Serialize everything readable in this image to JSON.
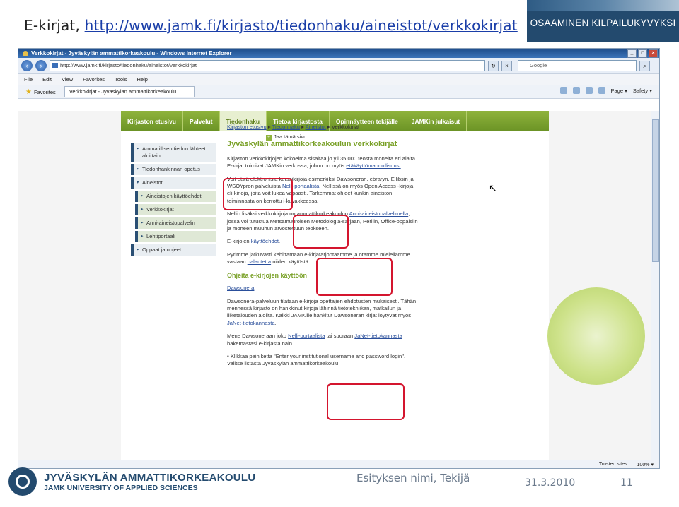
{
  "slide": {
    "title_prefix": "E-kirjat, ",
    "title_link": "http://www.jamk.fi/kirjasto/tiedonhaku/aineistot/verkkokirjat",
    "banner": "OSAAMINEN KILPAILUKYVYKSI",
    "footer_logo_line1": "JYVÄSKYLÄN AMMATTIKORKEAKOULU",
    "footer_logo_line2": "JAMK UNIVERSITY OF APPLIED SCIENCES",
    "presenter": "Esityksen nimi, Tekijä",
    "date": "31.3.2010",
    "page_number": "11"
  },
  "browser": {
    "window_title": "Verkkokirjat - Jyväskylän ammattikorkeakoulu - Windows Internet Explorer",
    "address": "http://www.jamk.fi/kirjasto/tiedonhaku/aineistot/verkkokirjat",
    "search_placeholder": "Google",
    "menu": [
      "File",
      "Edit",
      "View",
      "Favorites",
      "Tools",
      "Help"
    ],
    "favorites_label": "Favorites",
    "tab_label": "Verkkokirjat - Jyväskylän ammattikorkeakoulu",
    "cmd_page": "Page ▾",
    "cmd_safety": "Safety ▾",
    "status_trusted": "Trusted sites",
    "status_zoom": "100% ▾"
  },
  "site": {
    "nav": [
      "Kirjaston etusivu",
      "Palvelut",
      "Tiedonhaku",
      "Tietoa kirjastosta",
      "Opinnäytteen tekijälle",
      "JAMKin julkaisut"
    ],
    "sidebar": [
      "Ammatillisen tiedon lähteet aloittain",
      "Tiedonhankinnan opetus",
      "Aineistot",
      "Aineistojen käyttöehdot",
      "Verkkokirjat",
      "Anni-aineistopalvelin",
      "Lehtiportaali",
      "Oppaat ja ohjeet"
    ],
    "breadcrumb": [
      "Kirjaston etusivu",
      "Tiedonhaku",
      "Aineistot",
      "Verkkokirjat"
    ],
    "share": "Jaa tämä sivu",
    "heading": "Jyväskylän ammattikorkeakoulun verkkokirjat",
    "p1": "Kirjaston verkkokirjojen kokoelma sisältää jo yli 35 000 teosta monelta eri alalta. E-kirjat toimivat JAMKin verkossa, johon on myös",
    "p1_link": "etäkäyttömahdollisuus.",
    "p2a": "Voit etsiä elektronisia kurssikirjoja esimerkiksi Dawsoneran, ebraryn, Ellibsin ja WSOYpron palveluista ",
    "p2_link": "Nelli-portaalista",
    "p2b": ". Nellissä on myös Open Access -kirjoja eli kirjoja, joita voit lukea vapaasti. Tarkemmat ohjeet kunkin aineiston toiminnasta on kerrottu i-kuvakkeessa.",
    "p3a": "Nellin lisäksi verkkokirjoja on ammattikorkeakoulun ",
    "p3_link": "Anni-aineistopalvelimella",
    "p3b": ", jossa voi tutustua Metsämuuroisen Metodologia-sarjaan, Perliin, Office-oppaisiin ja moneen muuhun arvostettuun teokseen.",
    "p4a": "E-kirjojen ",
    "p4_link": "käyttöehdot",
    "p4b": ".",
    "p5a": "Pyrimme jatkuvasti kehittämään e-kirjatarjontaamme ja otamme mielellämme vastaan ",
    "p5_link": "palautetta",
    "p5b": " niiden käytöstä.",
    "subheading": "Ohjeita e-kirjojen käyttöön",
    "dawsonera_link": "Dawsonera",
    "p6a": "Dawsonera-palveluun tilataan e-kirjoja opettajien ehdotusten mukaisesti. Tähän mennessä kirjasto on hankkinut kirjoja lähinnä tietotekniikan, matkailun ja liiketalouden aloilta. Kaikki JAMKille hankitut Dawsoneran kirjat löytyvät myös ",
    "p6_link": "JaNet-tietokannasta",
    "p6b": ".",
    "p7a": "Mene Dawsoneraan joko ",
    "p7_link1": "Nelli-portaalista",
    "p7b": " tai suoraan ",
    "p7_link2": "JaNet-tietokannasta",
    "p7c": " hakemastasi e-kirjasta näin.",
    "bullet": "Klikkaa painiketta \"Enter your institutional username and password login\". Valitse listasta Jyväskylän ammattikorkeakoulu"
  }
}
